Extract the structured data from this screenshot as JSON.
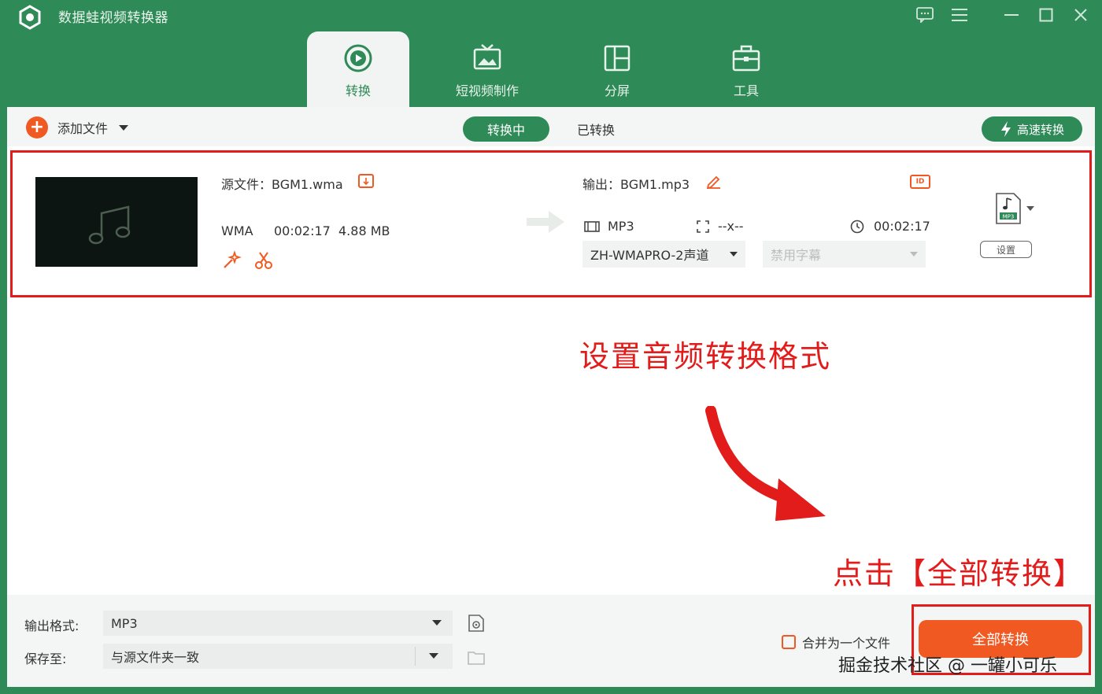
{
  "app": {
    "title": "数据蛙视频转换器"
  },
  "tabs": [
    {
      "label": "转换",
      "icon": "convert-icon",
      "active": true
    },
    {
      "label": "短视频制作",
      "icon": "tv-icon",
      "active": false
    },
    {
      "label": "分屏",
      "icon": "split-screen-icon",
      "active": false
    },
    {
      "label": "工具",
      "icon": "toolbox-icon",
      "active": false
    }
  ],
  "toolbar": {
    "add_file": "添加文件",
    "converting": "转换中",
    "converted": "已转换",
    "fast_convert": "高速转换"
  },
  "file": {
    "source_label": "源文件：BGM1.wma",
    "format": "WMA",
    "duration": "00:02:17",
    "size": "4.88 MB",
    "output_label": "输出：BGM1.mp3",
    "output_format": "MP3",
    "resolution": "--x--",
    "output_duration": "00:02:17",
    "audio_track": "ZH-WMAPRO-2声道",
    "subtitle": "禁用字幕",
    "settings": "设置",
    "id_badge": "ID",
    "file_icon_label": "MP3"
  },
  "annotations": {
    "set_format": "设置音频转换格式",
    "click_convert": "点击【全部转换】"
  },
  "bottom": {
    "output_format_label": "输出格式:",
    "output_format_value": "MP3",
    "save_to_label": "保存至:",
    "save_to_value": "与源文件夹一致",
    "merge_label": "合并为一个文件",
    "convert_all": "全部转换"
  },
  "watermark": "掘金技术社区 @ 一罐小可乐",
  "colors": {
    "brand_green": "#2e8a57",
    "accent_orange": "#f05a22",
    "annotation_red": "#e21b1b"
  }
}
